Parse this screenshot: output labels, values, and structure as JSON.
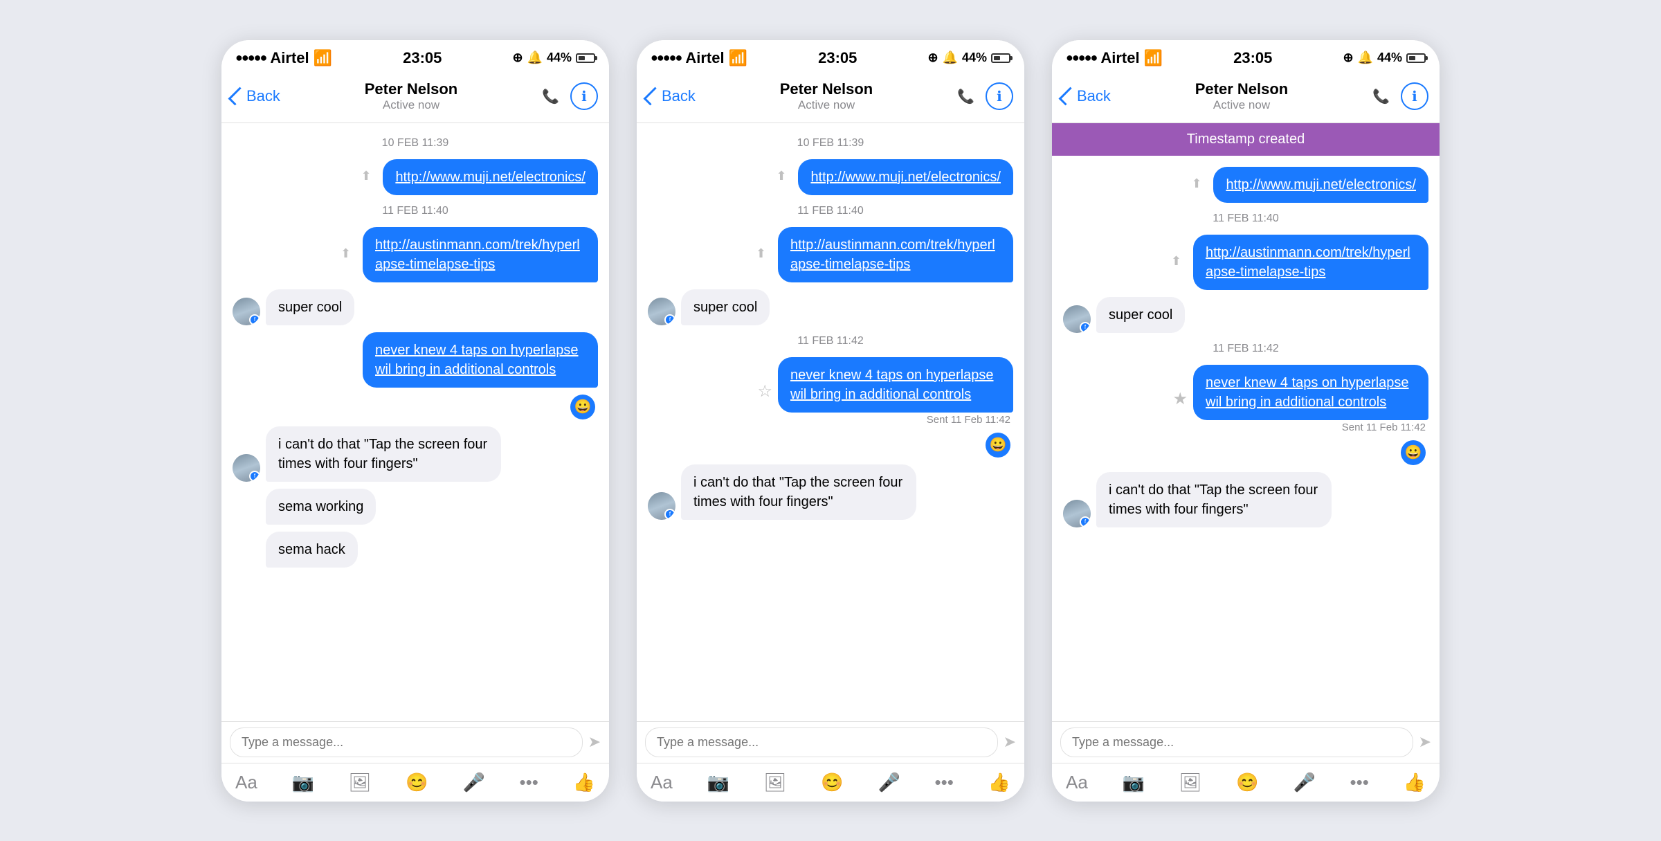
{
  "phones": [
    {
      "id": "phone1",
      "statusBar": {
        "carrier": "Airtel",
        "time": "23:05",
        "battery": "44%"
      },
      "navBar": {
        "back": "Back",
        "name": "Peter Nelson",
        "status": "Active now"
      },
      "timestampBanner": null,
      "messages": [
        {
          "type": "timestamp",
          "text": "10 FEB 11:39"
        },
        {
          "type": "sent-link",
          "text": "http://www.muji.net/electronics/"
        },
        {
          "type": "timestamp",
          "text": "11 FEB 11:40"
        },
        {
          "type": "sent-link",
          "text": "http://austinmann.com/trek/hyperlapse-timelapse-tips"
        },
        {
          "type": "received",
          "text": "super cool",
          "hasAvatar": true
        },
        {
          "type": "sent",
          "text": "never knew 4 taps on hyperlapse wil bring in additional controls"
        },
        {
          "type": "emoji-reaction",
          "emoji": "😀"
        },
        {
          "type": "received",
          "text": "i can't do that \"Tap the screen four times with four fingers\"",
          "hasAvatar": true
        },
        {
          "type": "received",
          "text": "sema working",
          "hasAvatar": false
        },
        {
          "type": "received",
          "text": "sema hack",
          "hasAvatar": false
        }
      ],
      "inputPlaceholder": "Type a message...",
      "toolbar": [
        "Aa",
        "📷",
        "🖼",
        "😊",
        "🎤",
        "•••",
        "👍"
      ]
    },
    {
      "id": "phone2",
      "statusBar": {
        "carrier": "Airtel",
        "time": "23:05",
        "battery": "44%"
      },
      "navBar": {
        "back": "Back",
        "name": "Peter Nelson",
        "status": "Active now"
      },
      "timestampBanner": null,
      "messages": [
        {
          "type": "timestamp",
          "text": "10 FEB 11:39"
        },
        {
          "type": "sent-link",
          "text": "http://www.muji.net/electronics/"
        },
        {
          "type": "timestamp",
          "text": "11 FEB 11:40"
        },
        {
          "type": "sent-link",
          "text": "http://austinmann.com/trek/hyperlapse-timelapse-tips"
        },
        {
          "type": "received",
          "text": "super cool",
          "hasAvatar": true
        },
        {
          "type": "timestamp",
          "text": "11 FEB 11:42"
        },
        {
          "type": "sent-with-timestamp",
          "text": "never knew 4 taps on hyperlapse wil bring in additional controls",
          "sentLabel": "Sent 11 Feb 11:42",
          "starIcon": "☆"
        },
        {
          "type": "emoji-reaction",
          "emoji": "😀"
        },
        {
          "type": "received",
          "text": "i can't do that \"Tap the screen four times with four fingers\"",
          "hasAvatar": true
        }
      ],
      "inputPlaceholder": "Type a message...",
      "toolbar": [
        "Aa",
        "📷",
        "🖼",
        "😊",
        "🎤",
        "•••",
        "👍"
      ]
    },
    {
      "id": "phone3",
      "statusBar": {
        "carrier": "Airtel",
        "time": "23:05",
        "battery": "44%"
      },
      "navBar": {
        "back": "Back",
        "name": "Peter Nelson",
        "status": "Active now"
      },
      "timestampBanner": "Timestamp created",
      "messages": [
        {
          "type": "sent-link",
          "text": "http://www.muji.net/electronics/"
        },
        {
          "type": "timestamp",
          "text": "11 FEB 11:40"
        },
        {
          "type": "sent-link",
          "text": "http://austinmann.com/trek/hyperlapse-timelapse-tips"
        },
        {
          "type": "received",
          "text": "super cool",
          "hasAvatar": true
        },
        {
          "type": "timestamp",
          "text": "11 FEB 11:42"
        },
        {
          "type": "sent-with-timestamp",
          "text": "never knew 4 taps on hyperlapse wil bring in additional controls",
          "sentLabel": "Sent 11 Feb 11:42",
          "starIcon": "★"
        },
        {
          "type": "emoji-reaction",
          "emoji": "😀"
        },
        {
          "type": "received",
          "text": "i can't do that \"Tap the screen four times with four fingers\"",
          "hasAvatar": true
        }
      ],
      "inputPlaceholder": "Type a message...",
      "toolbar": [
        "Aa",
        "📷",
        "🖼",
        "😊",
        "🎤",
        "•••",
        "👍"
      ]
    }
  ]
}
